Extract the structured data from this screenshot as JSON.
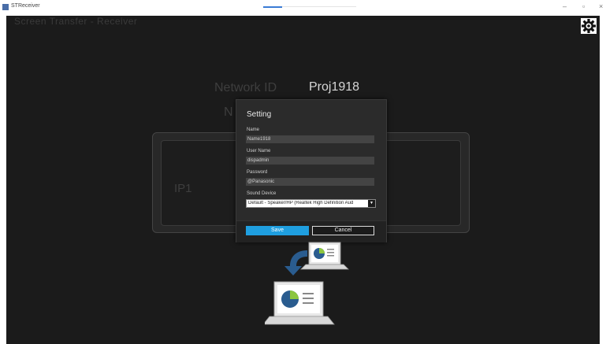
{
  "window": {
    "title": "STReceiver",
    "icon": "app-icon"
  },
  "app": {
    "header": "Screen Transfer - Receiver",
    "settings_icon": "gear-icon",
    "network_id_label": "Network ID",
    "network_id_value": "Proj1918",
    "name_label": "N",
    "ip_label": "IP1"
  },
  "dialog": {
    "title": "Setting",
    "fields": {
      "name": {
        "label": "Name",
        "value": "Name1918"
      },
      "user_name": {
        "label": "User Name",
        "value": "dispadmin"
      },
      "password": {
        "label": "Password",
        "value": "@Panasonic"
      },
      "sound_device": {
        "label": "Sound Device",
        "value": "Default - Speaker/HP (Realtek High Definition Aud"
      }
    },
    "save_label": "Save",
    "cancel_label": "Cancel"
  },
  "colors": {
    "background": "#1b1b1b",
    "dialog": "#2b2b2b",
    "accent": "#1f9fe0"
  }
}
